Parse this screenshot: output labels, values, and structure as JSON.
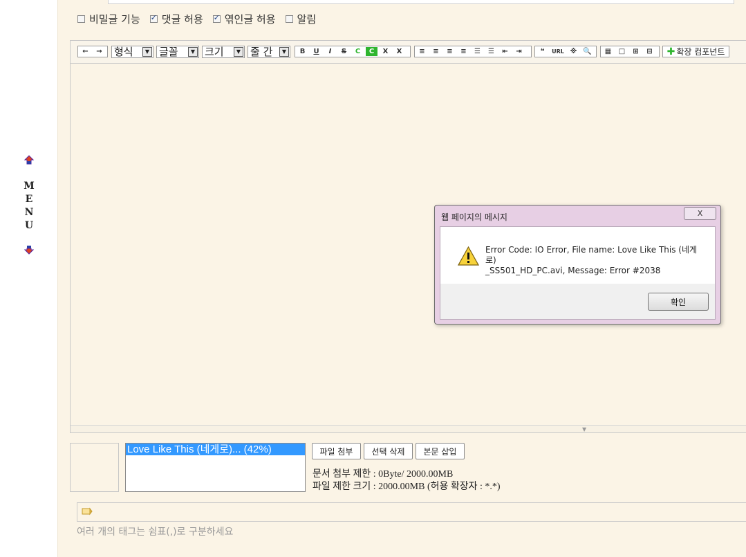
{
  "side_menu": {
    "up_icon": "up-arrow-icon",
    "letters": [
      "M",
      "E",
      "N",
      "U"
    ],
    "down_icon": "down-arrow-icon"
  },
  "options": [
    {
      "label": "비밀글 기능",
      "checked": false
    },
    {
      "label": "댓글 허용",
      "checked": true
    },
    {
      "label": "엮인글 허용",
      "checked": true
    },
    {
      "label": "알림",
      "checked": false
    }
  ],
  "toolbar": {
    "undo_label": "←",
    "redo_label": "→",
    "format_label": "형식",
    "font_label": "글꼴",
    "size_label": "크기",
    "line_height_label": "줄 간",
    "dropdown_arrow": "▼",
    "text_style": [
      "B",
      "U",
      "I",
      "S",
      "C",
      "C",
      "X",
      "X"
    ],
    "align": [
      "≡",
      "≡",
      "≡",
      "≡",
      "☰",
      "☰",
      "⇤",
      "⇥"
    ],
    "insert": [
      "❝",
      "URL",
      "※",
      "🔍"
    ],
    "table": [
      "▦",
      "□",
      "⊞",
      "⊟"
    ],
    "extend_label": "확장 컴포넌트",
    "extend_icon": "plus-icon"
  },
  "dialog": {
    "title": "웹 페이지의 메시지",
    "close_label": "X",
    "message_line1": "Error Code: IO Error, File name: Love Like This (네게로)",
    "message_line2": "_SS501_HD_PC.avi, Message: Error #2038",
    "ok_label": "확인",
    "icon": "warning-icon"
  },
  "attachments": {
    "files": [
      {
        "label": "Love Like This (네게로)... (42%)",
        "progress_percent": 42
      }
    ],
    "attach_button": "파일 첨부",
    "delete_button": "선택 삭제",
    "insert_button": "본문 삽입",
    "doc_limit": "문서 첨부 제한 : 0Byte/ 2000.00MB",
    "file_limit": "파일 제한 크기 : 2000.00MB (허용 확장자 : *.*)"
  },
  "tags": {
    "icon": "tag-pencil-icon",
    "hint": "여러 개의 태그는 쉼표(,)로 구분하세요"
  },
  "colors": {
    "page_bg": "#fbf4e6",
    "selection": "#3399ff",
    "dialog_frame": "#e7cfe4",
    "green_accent": "#2fb52f"
  }
}
